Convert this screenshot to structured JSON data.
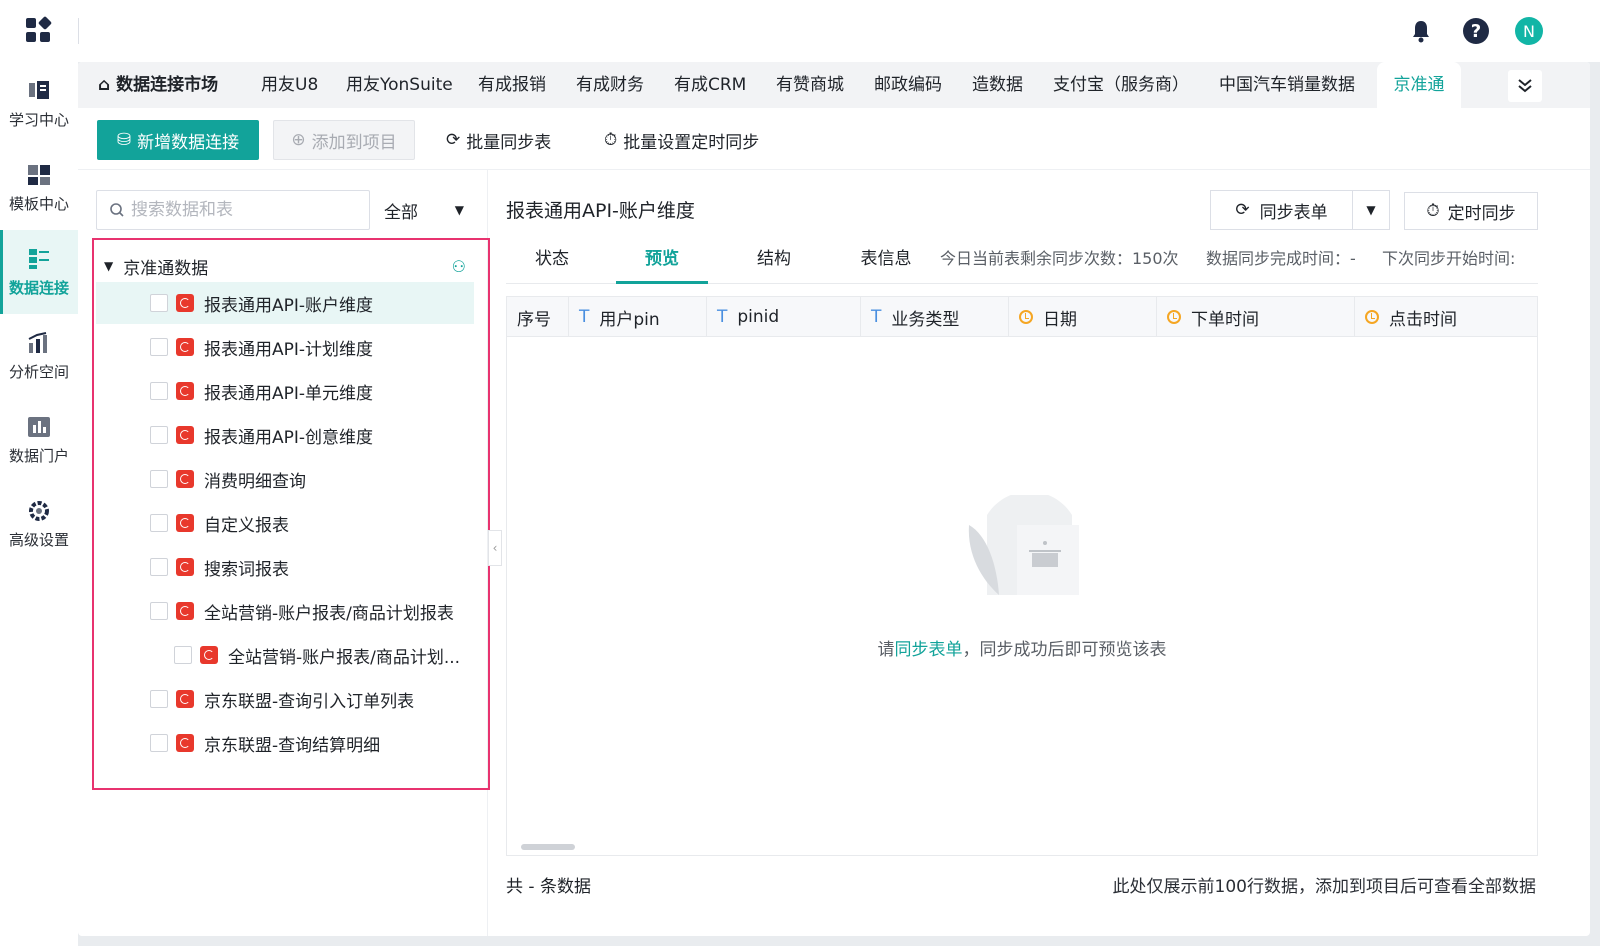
{
  "sidebar": {
    "items": [
      {
        "label": "学习中心",
        "icon": "book-icon"
      },
      {
        "label": "模板中心",
        "icon": "template-icon"
      },
      {
        "label": "数据连接",
        "icon": "data-connect-icon",
        "active": true
      },
      {
        "label": "分析空间",
        "icon": "analysis-icon"
      },
      {
        "label": "数据门户",
        "icon": "portal-icon"
      },
      {
        "label": "高级设置",
        "icon": "gear-icon"
      }
    ]
  },
  "header": {
    "avatar_letter": "N"
  },
  "tabs": {
    "home": "数据连接市场",
    "items": [
      "用友U8",
      "用友YonSuite",
      "有成报销",
      "有成财务",
      "有成CRM",
      "有赞商城",
      "邮政编码",
      "造数据",
      "支付宝（服务商）",
      "中国汽车销量数据",
      "京准通"
    ],
    "active": "京准通"
  },
  "toolbar": {
    "add_connection": "新增数据连接",
    "add_to_project": "添加到项目",
    "batch_sync": "批量同步表",
    "batch_schedule": "批量设置定时同步"
  },
  "left": {
    "search_placeholder": "搜索数据和表",
    "filter_value": "全部",
    "tree_root": "京准通数据",
    "tree_items": [
      "报表通用API-账户维度",
      "报表通用API-计划维度",
      "报表通用API-单元维度",
      "报表通用API-创意维度",
      "消费明细查询",
      "自定义报表",
      "搜索词报表",
      "全站营销-账户报表/商品计划报表",
      "全站营销-账户报表/商品计划...",
      "京东联盟-查询引入订单列表",
      "京东联盟-查询结算明细"
    ]
  },
  "right": {
    "title": "报表通用API-账户维度",
    "sync_button": "同步表单",
    "timer_button": "定时同步",
    "subtabs": [
      "状态",
      "预览",
      "结构",
      "表信息"
    ],
    "active_subtab": "预览",
    "info_remaining": "今日当前表剩余同步次数：150次",
    "info_done": "数据同步完成时间：-",
    "info_next": "下次同步开始时间:",
    "columns": [
      {
        "label": "序号",
        "type": ""
      },
      {
        "label": "用户pin",
        "type": "text"
      },
      {
        "label": "pinid",
        "type": "text"
      },
      {
        "label": "业务类型",
        "type": "text"
      },
      {
        "label": "日期",
        "type": "time"
      },
      {
        "label": "下单时间",
        "type": "time"
      },
      {
        "label": "点击时间",
        "type": "time"
      }
    ],
    "empty_prefix": "请",
    "empty_link": "同步表单",
    "empty_suffix": "，同步成功后即可预览该表",
    "footer_count": "共 - 条数据",
    "footer_note": "此处仅展示前100行数据，添加到项目后可查看全部数据"
  },
  "colors": {
    "accent": "#12a39a",
    "highlight_border": "#e8336f",
    "jzt_icon": "#e8382c"
  }
}
